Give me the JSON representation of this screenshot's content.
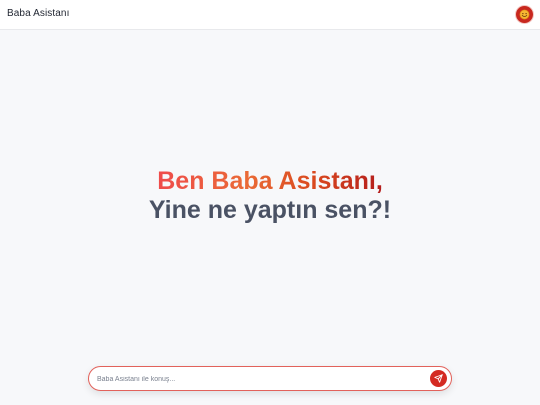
{
  "header": {
    "title": "Baba Asistanı",
    "avatar_icon": "smiley-face-icon"
  },
  "hero": {
    "line1": "Ben Baba Asistanı,",
    "line2": "Yine ne yaptın sen?!"
  },
  "composer": {
    "placeholder": "Baba Asistanı ile konuş...",
    "value": "",
    "send_icon": "paper-plane-icon"
  },
  "colors": {
    "accent": "#d42a22",
    "hero_gradient_start": "#ef4b4b",
    "hero_gradient_end": "#b31d1d",
    "hero_secondary": "#4a5264",
    "background": "#f7f8fa"
  }
}
